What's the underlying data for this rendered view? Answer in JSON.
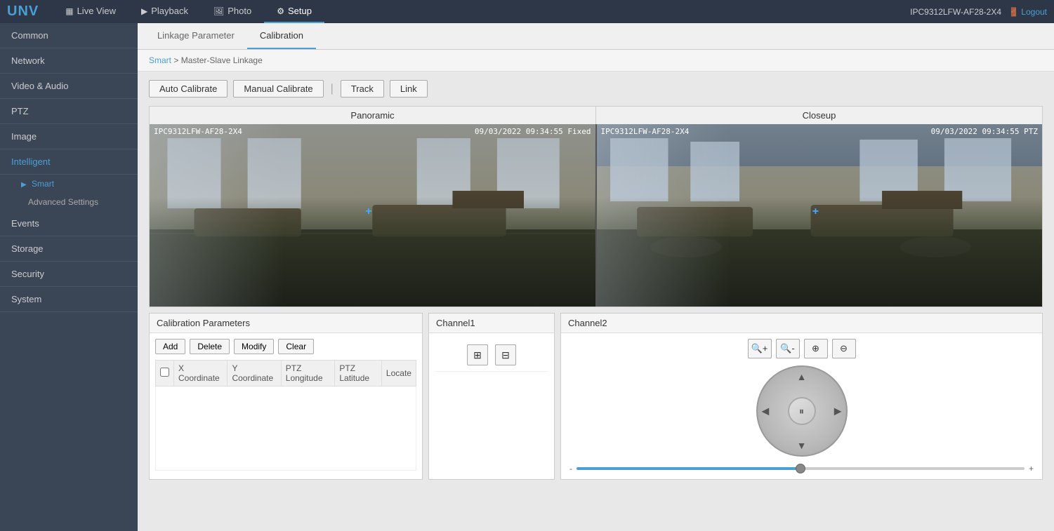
{
  "topNav": {
    "logo": "UNV",
    "items": [
      {
        "id": "live-view",
        "label": "Live View",
        "icon": "▦",
        "active": false
      },
      {
        "id": "playback",
        "label": "Playback",
        "icon": "▶",
        "active": false
      },
      {
        "id": "photo",
        "label": "Photo",
        "icon": "🖼",
        "active": false
      },
      {
        "id": "setup",
        "label": "Setup",
        "icon": "⚙",
        "active": true
      }
    ],
    "deviceInfo": "IPC9312LFW-AF28-2X4",
    "logoutLabel": "Logout"
  },
  "sidebar": {
    "items": [
      {
        "id": "common",
        "label": "Common",
        "active": false
      },
      {
        "id": "network",
        "label": "Network",
        "active": false
      },
      {
        "id": "video-audio",
        "label": "Video & Audio",
        "active": false
      },
      {
        "id": "ptz",
        "label": "PTZ",
        "active": false
      },
      {
        "id": "image",
        "label": "Image",
        "active": false
      },
      {
        "id": "intelligent",
        "label": "Intelligent",
        "active": true
      },
      {
        "id": "smart",
        "label": "Smart",
        "active": true,
        "sub": true
      },
      {
        "id": "advanced-settings",
        "label": "Advanced Settings",
        "active": false,
        "sub2": true
      },
      {
        "id": "events",
        "label": "Events",
        "active": false
      },
      {
        "id": "storage",
        "label": "Storage",
        "active": false
      },
      {
        "id": "security",
        "label": "Security",
        "active": false
      },
      {
        "id": "system",
        "label": "System",
        "active": false
      }
    ]
  },
  "tabs": [
    {
      "id": "linkage-parameter",
      "label": "Linkage Parameter",
      "active": false
    },
    {
      "id": "calibration",
      "label": "Calibration",
      "active": true
    }
  ],
  "breadcrumb": {
    "link": "Smart",
    "separator": ">",
    "current": "Master-Slave Linkage"
  },
  "actionButtons": {
    "autoCalibrate": "Auto Calibrate",
    "manualCalibrate": "Manual Calibrate",
    "track": "Track",
    "link": "Link"
  },
  "cameraViews": {
    "panoramic": {
      "label": "Panoramic",
      "overlayLeft": "IPC9312LFW-AF28-2X4",
      "overlayRight": "09/03/2022 09:34:55 Fixed"
    },
    "closeup": {
      "label": "Closeup",
      "overlayLeft": "IPC9312LFW-AF28-2X4",
      "overlayRight": "09/03/2022 09:34:55 PTZ"
    }
  },
  "calibrationPanel": {
    "title": "Calibration Parameters",
    "buttons": {
      "add": "Add",
      "delete": "Delete",
      "modify": "Modify",
      "clear": "Clear"
    },
    "tableHeaders": [
      "X Coordinate",
      "Y Coordinate",
      "PTZ Longitude",
      "PTZ Latitude",
      "Locate"
    ]
  },
  "channel1Panel": {
    "title": "Channel1"
  },
  "channel2Panel": {
    "title": "Channel2",
    "zoomIn": "+",
    "zoomOut": "-",
    "focusNear": "◄",
    "focusFar": "►",
    "sliderMin": "-",
    "sliderMax": "+"
  }
}
